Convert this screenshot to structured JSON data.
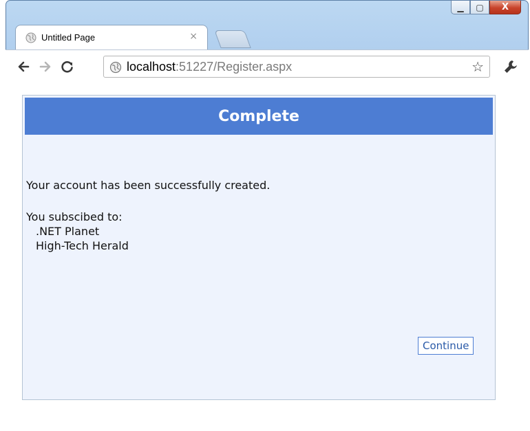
{
  "window": {
    "caption_buttons": {
      "minimize_glyph": "▁",
      "maximize_glyph": "▢",
      "close_glyph": "X"
    }
  },
  "tab": {
    "title": "Untitled Page",
    "close_glyph": "×",
    "favicon": "globe-icon"
  },
  "toolbar": {
    "back_icon": "back-arrow-icon",
    "forward_icon": "forward-arrow-icon",
    "reload_icon": "reload-icon",
    "url_host": "localhost",
    "url_rest": ":51227/Register.aspx",
    "bookmark_glyph": "☆",
    "settings_icon": "wrench-icon"
  },
  "page": {
    "header_title": "Complete",
    "success_message": "Your account has been successfully created.",
    "subscriptions_label": "You subscibed to:",
    "subscriptions": [
      ".NET Planet",
      "High-Tech Herald"
    ],
    "continue_label": "Continue"
  },
  "colors": {
    "header_bg": "#4d7dd3",
    "panel_bg": "#eef3fd",
    "close_button": "#c8432b"
  }
}
